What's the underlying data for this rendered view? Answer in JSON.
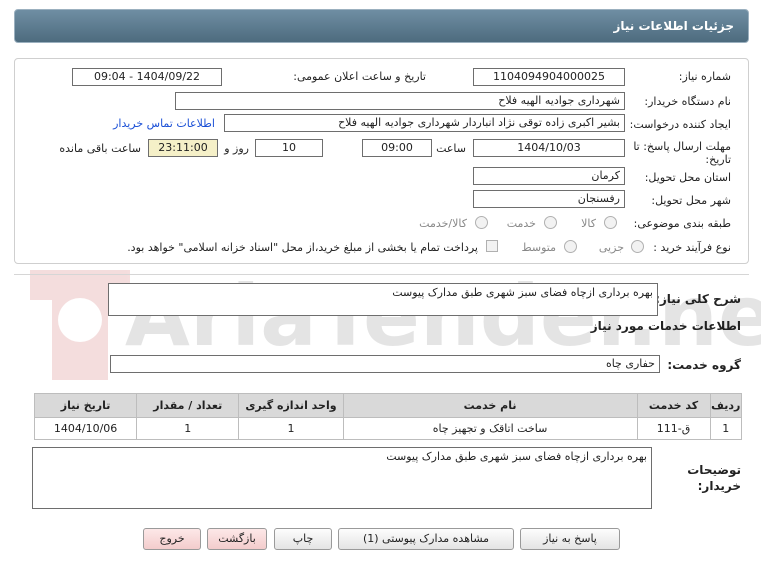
{
  "header": {
    "title": "جزئیات اطلاعات نیاز"
  },
  "form": {
    "need_number_label": "شماره نیاز:",
    "need_number": "1104094904000025",
    "announce_label": "تاریخ و ساعت اعلان عمومی:",
    "announce_value": "1404/09/22 - 09:04",
    "buyer_org_label": "نام دستگاه خریدار:",
    "buyer_org": "شهرداری جوادیه الهیه فلاح",
    "creator_label": "ایجاد کننده درخواست:",
    "creator": "بشیر اکبری زاده توقی نژاد انباردار شهرداری جوادیه الهیه فلاح",
    "contact_link": "اطلاعات تماس خریدار",
    "deadline_label_1": "مهلت ارسال پاسخ: تا",
    "deadline_label_2": "تاریخ:",
    "deadline_date": "1404/10/03",
    "time_label": "ساعت",
    "deadline_time": "09:00",
    "days_value": "10",
    "days_label": "روز و",
    "remaining_time": "23:11:00",
    "remaining_label": "ساعت باقی مانده",
    "province_label": "استان محل تحویل:",
    "province": "کرمان",
    "city_label": "شهر محل تحویل:",
    "city": "رفسنجان",
    "category_label": "طبقه بندی موضوعی:",
    "category_options": [
      "کالا",
      "خدمت",
      "کالا/خدمت"
    ],
    "process_label": "نوع فرآیند خرید :",
    "process_options": [
      "جزیی",
      "متوسط"
    ],
    "payment_note": "پرداخت تمام یا بخشی از مبلغ خرید،از محل \"اسناد خزانه اسلامی\" خواهد بود."
  },
  "description": {
    "label": "شرح کلی نیاز:",
    "value": "بهره برداری ازچاه فضای سبز شهری طبق مدارک پیوست"
  },
  "services": {
    "section_title": "اطلاعات خدمات مورد نیاز",
    "group_label": "گروه خدمت:",
    "group_value": "حفاری چاه",
    "columns": [
      "ردیف",
      "کد خدمت",
      "نام خدمت",
      "واحد اندازه گیری",
      "تعداد / مقدار",
      "تاریخ نیاز"
    ],
    "rows": [
      {
        "index": "1",
        "code": "ق-111",
        "name": "ساخت اتاقک و تجهیز چاه",
        "unit": "1",
        "qty": "1",
        "date": "1404/10/06"
      }
    ]
  },
  "notes": {
    "label_1": "توضیحات",
    "label_2": "خریدار:",
    "value": "بهره برداری ازچاه فضای سبز شهری طبق مدارک پیوست"
  },
  "buttons": {
    "reply": "پاسخ به نیاز",
    "attachments": "مشاهده مدارک پیوستی (1)",
    "print": "چاپ",
    "back": "بازگشت",
    "exit": "خروج"
  },
  "watermark": {
    "text": "AriaTender.net"
  },
  "colors": {
    "header_bg": "#5b7a8e",
    "link": "#1a4fd6",
    "accent_pink": "#f3cccc"
  }
}
